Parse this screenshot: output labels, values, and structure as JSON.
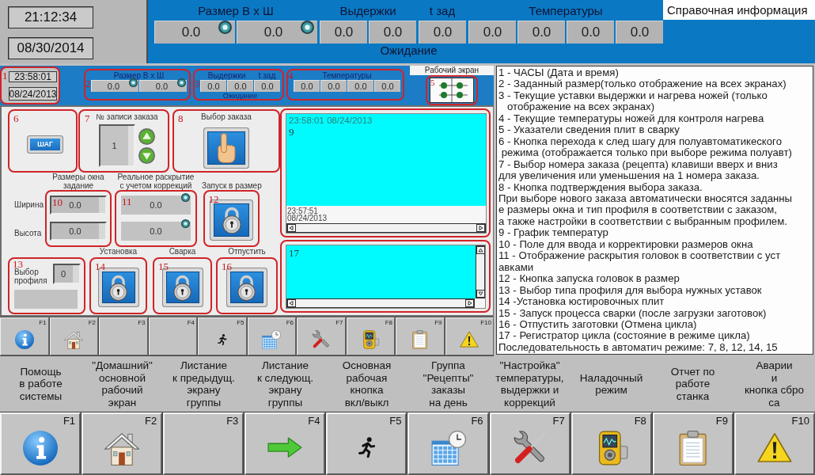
{
  "clock": {
    "time": "21:12:34",
    "date": "08/30/2014"
  },
  "header": {
    "groups": [
      {
        "label": "Размер В х Ш",
        "fields": [
          {
            "value": "0.0",
            "kind": "indicator"
          },
          {
            "value": "0.0",
            "kind": "indicator"
          }
        ]
      },
      {
        "label": "Выдержки",
        "fields": [
          {
            "value": "0.0",
            "kind": "plain"
          },
          {
            "value": "0.0",
            "kind": "plain"
          }
        ]
      },
      {
        "label": "t зад",
        "fields": [
          {
            "value": "0.0",
            "kind": "plain"
          }
        ]
      },
      {
        "label": "Температуры",
        "fields": [
          {
            "value": "0.0",
            "kind": "plain"
          },
          {
            "value": "0.0",
            "kind": "plain"
          },
          {
            "value": "0.0",
            "kind": "plain"
          },
          {
            "value": "0.0",
            "kind": "plain"
          }
        ]
      }
    ],
    "status": "Ожидание"
  },
  "help_tab": {
    "label": "Справочная информация"
  },
  "preview": {
    "clock": {
      "marker": "1",
      "time": "23:58:01",
      "date": "08/24/2013"
    },
    "groups": [
      {
        "marker": "2",
        "columns": [
          {
            "label": "Размер В х Ш",
            "fields": [
              {
                "value": "0.0",
                "kind": "indicator"
              },
              {
                "value": "0.0",
                "kind": "indicator"
              }
            ]
          }
        ]
      },
      {
        "marker": "3",
        "columns": [
          {
            "label": "Выдержки",
            "fields": [
              {
                "value": "0.0",
                "kind": "plain"
              },
              {
                "value": "0.0",
                "kind": "plain"
              }
            ]
          },
          {
            "label": "t зад",
            "fields": [
              {
                "value": "0.0",
                "kind": "plain"
              }
            ]
          }
        ],
        "status": "Ожидание"
      },
      {
        "marker": "4",
        "columns": [
          {
            "label": "Температуры",
            "fields": [
              {
                "value": "0.0",
                "kind": "plain"
              },
              {
                "value": "0.0",
                "kind": "plain"
              },
              {
                "value": "0.0",
                "kind": "plain"
              },
              {
                "value": "0.0",
                "kind": "plain"
              }
            ]
          }
        ]
      }
    ],
    "work_screen": {
      "label": "Рабочий экран",
      "marker": "5"
    },
    "step": {
      "marker": "6",
      "button": "ШАГ"
    },
    "order_number": {
      "marker": "7",
      "label": "№ записи заказа",
      "value": "1"
    },
    "order_select": {
      "marker": "8",
      "label": "Выбор заказа"
    },
    "window_size": {
      "marker": "10",
      "label": "Размеры окна\nзадание",
      "rows": [
        {
          "label": "Ширина",
          "value": "0.0"
        },
        {
          "label": "Высота",
          "value": "0.0"
        }
      ]
    },
    "opening": {
      "marker": "11",
      "label": "Реальное раскрытие\nс учетом коррекций",
      "values": [
        "0.0",
        "0.0"
      ]
    },
    "size_start": {
      "marker": "12",
      "label": "Запуск в размер"
    },
    "profile": {
      "marker": "13",
      "label": "Выбор\nпрофиля",
      "value": "0"
    },
    "actions": [
      {
        "marker": "14",
        "label": "Установка"
      },
      {
        "marker": "15",
        "label": "Сварка"
      },
      {
        "marker": "16",
        "label": "Отпустить"
      }
    ],
    "trend": {
      "marker": "9",
      "start": "23:58:01 08/24/2013",
      "end": "23:57:51\n08/24/2013"
    },
    "cycle_log": {
      "marker": "17"
    },
    "keys": [
      "F1",
      "F2",
      "F3",
      "F4",
      "F5",
      "F6",
      "F7",
      "F8",
      "F9",
      "F10"
    ]
  },
  "legend": {
    "items": [
      "1 - ЧАСЫ (Дата и время)",
      "2 - Заданный размер(только отображение на всех экранах)",
      "3 - Текущие уставки выдержки и нагрева ножей (только\n   отображение на всех экранах)",
      "4 - Текущие температуры ножей для контроля нагрева",
      "5 - Указатели сведения плит в сварку",
      "6 - Кнопка перехода к след шагу для полуавтоматикеского\n режима (отображается только при выборе режима полуавт)",
      "7 - Выбор номера заказа (рецепта) клавиши вверх и вниз\nдля увеличения или уменьшения на 1 номера заказа.",
      "8 - Кнопка подтверждения выбора заказа.",
      "При выборе нового заказа автоматически вносятся заданны\nе размеры окна и тип профиля в соответствии с заказом,\nа также настройки в соответствии с выбранным профилем.",
      "9 - График температур",
      "10 - Поле для ввода и корректировки размеров окна",
      "11 - Отображение раскрытия головок в соответствии с уст\nавками",
      "12 - Кнопка запуска головок в размер",
      "13 - Выбор типа профиля для выбора нужных уставок",
      "14 -Установка юстировочных плит",
      "15 - Запуск процесса сварки (после загрузки заготовок)",
      "16 - Отпустить заготовки (Отмена цикла)",
      "17 - Регистратор цикла (состояние в режиме цикла)",
      "Последовательность в автоматич режиме: 7, 8, 12, 14, 15"
    ]
  },
  "function_keys": [
    {
      "key": "F1",
      "caption": "Помощь\nв работе\nсистемы"
    },
    {
      "key": "F2",
      "caption": "\"Домашний\"\nосновной\nрабочий\nэкран"
    },
    {
      "key": "F3",
      "caption": "Листание\nк предыдущ.\nэкрану\nгруппы"
    },
    {
      "key": "F4",
      "caption": "Листание\nк следующ.\nэкрану\nгруппы"
    },
    {
      "key": "F5",
      "caption": "Основная\nрабочая\nкнопка\nвкл/выкл"
    },
    {
      "key": "F6",
      "caption": "Группа\n\"Рецепты\"\nзаказы\nна день"
    },
    {
      "key": "F7",
      "caption": "\"Настройка\"\nтемпературы,\nвыдержки и\nкоррекций"
    },
    {
      "key": "F8",
      "caption": "Наладочный\nрежим"
    },
    {
      "key": "F9",
      "caption": "Отчет по\nработе\nстанка"
    },
    {
      "key": "F10",
      "caption": "Аварии\nи\nкнопка сбро\nса"
    }
  ]
}
